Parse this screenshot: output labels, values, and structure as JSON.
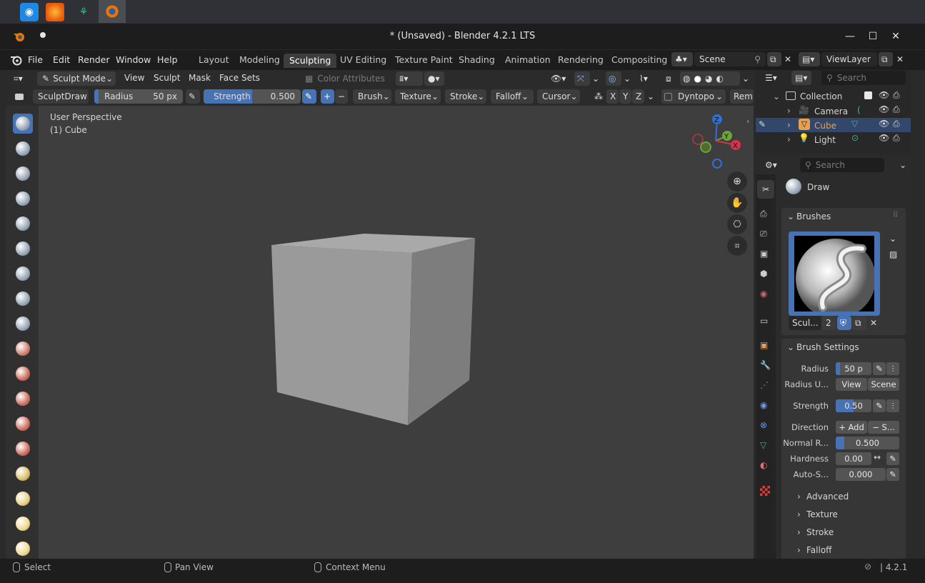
{
  "window": {
    "title": "* (Unsaved) - Blender 4.2.1 LTS"
  },
  "menu": [
    "File",
    "Edit",
    "Render",
    "Window",
    "Help"
  ],
  "workspace_tabs": [
    "Layout",
    "Modeling",
    "Sculpting",
    "UV Editing",
    "Texture Paint",
    "Shading",
    "Animation",
    "Rendering",
    "Compositing"
  ],
  "active_workspace": "Sculpting",
  "scene": {
    "name": "Scene",
    "view_layer": "ViewLayer"
  },
  "header": {
    "mode": "Sculpt Mode",
    "menus": [
      "View",
      "Sculpt",
      "Mask",
      "Face Sets"
    ],
    "color_attributes": "Color Attributes"
  },
  "tool_settings": {
    "brush_name": "SculptDraw",
    "radius_label": "Radius",
    "radius_value": "50 px",
    "strength_label": "Strength",
    "strength_value": "0.500",
    "strength_fraction": 0.5,
    "dropdowns": [
      "Brush",
      "Texture",
      "Stroke",
      "Falloff",
      "Cursor"
    ],
    "axes": [
      "X",
      "Y",
      "Z"
    ],
    "dyntopo": "Dyntopo",
    "remesh": "Rem"
  },
  "viewport": {
    "perspective": "User Perspective",
    "object": "(1) Cube"
  },
  "gizmo": {
    "z": "Z",
    "y": "Y",
    "x": "X"
  },
  "outliner": {
    "search_placeholder": "Search",
    "collection": "Collection",
    "items": [
      {
        "name": "Camera",
        "color": "#d8d8d8"
      },
      {
        "name": "Cube",
        "color": "#f0a33a"
      },
      {
        "name": "Light",
        "color": "#d8d8d8"
      }
    ]
  },
  "properties": {
    "search_placeholder": "Search",
    "tool_name": "Draw",
    "brushes_title": "Brushes",
    "brush_short": "Scul...",
    "brush_users": "2",
    "brush_settings_title": "Brush Settings",
    "radius_label": "Radius",
    "radius_value": "50 p",
    "radius_unit_label": "Radius U...",
    "radius_unit_view": "View",
    "radius_unit_scene": "Scene",
    "strength_label": "Strength",
    "strength_value": "0.50",
    "direction_label": "Direction",
    "direction_add": "+ Add",
    "direction_sub": "− S...",
    "normal_radius_label": "Normal R...",
    "normal_radius_value": "0.500",
    "normal_radius_fraction": 0.13,
    "hardness_label": "Hardness",
    "hardness_value": "0.00",
    "autosmooth_label": "Auto-S...",
    "autosmooth_value": "0.000",
    "subpanels": [
      "Advanced",
      "Texture",
      "Stroke",
      "Falloff"
    ]
  },
  "statusbar": {
    "select": "Select",
    "pan": "Pan View",
    "context": "Context Menu",
    "version": "4.2.1"
  },
  "colors": {
    "accent": "#4772b3",
    "selected_object": "#f0a33a"
  }
}
